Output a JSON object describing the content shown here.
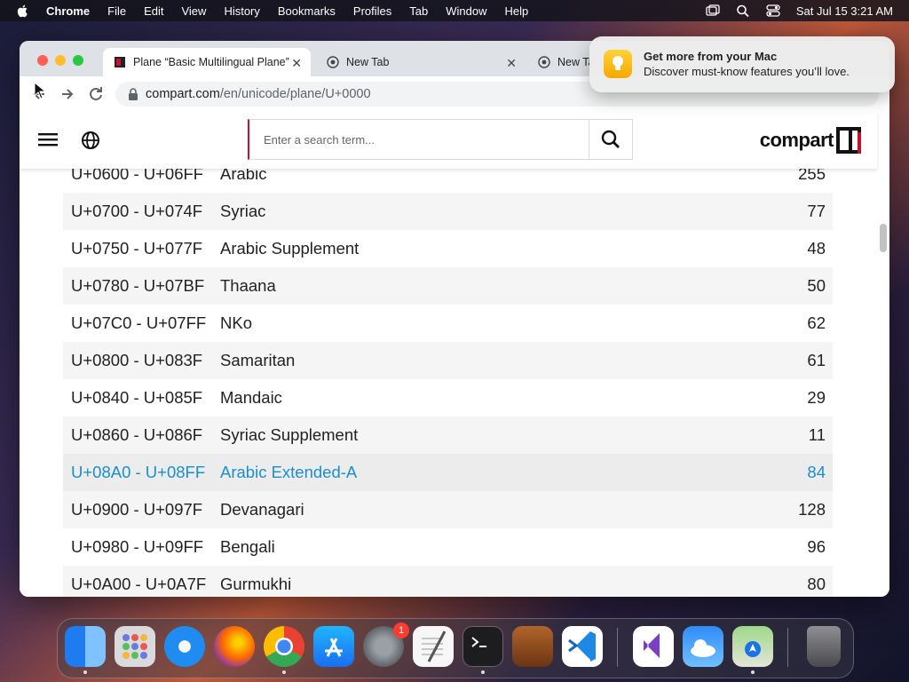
{
  "menubar": {
    "app_name": "Chrome",
    "items": [
      "File",
      "Edit",
      "View",
      "History",
      "Bookmarks",
      "Profiles",
      "Tab",
      "Window",
      "Help"
    ],
    "clock": "Sat Jul 15  3:21 AM"
  },
  "browser": {
    "tabs": [
      {
        "title": "Plane “Basic Multilingual Plane”",
        "active": true
      },
      {
        "title": "New Tab",
        "active": false
      },
      {
        "title": "New Tab",
        "active": false
      }
    ],
    "url_domain": "compart.com",
    "url_path": "/en/unicode/plane/U+0000"
  },
  "site": {
    "search_placeholder": "Enter a search term...",
    "logo_text": "compart"
  },
  "blocks": [
    {
      "range": "U+0600 - U+06FF",
      "name": "Arabic",
      "count": "255"
    },
    {
      "range": "U+0700 - U+074F",
      "name": "Syriac",
      "count": "77"
    },
    {
      "range": "U+0750 - U+077F",
      "name": "Arabic Supplement",
      "count": "48"
    },
    {
      "range": "U+0780 - U+07BF",
      "name": "Thaana",
      "count": "50"
    },
    {
      "range": "U+07C0 - U+07FF",
      "name": "NKo",
      "count": "62"
    },
    {
      "range": "U+0800 - U+083F",
      "name": "Samaritan",
      "count": "61"
    },
    {
      "range": "U+0840 - U+085F",
      "name": "Mandaic",
      "count": "29"
    },
    {
      "range": "U+0860 - U+086F",
      "name": "Syriac Supplement",
      "count": "11"
    },
    {
      "range": "U+08A0 - U+08FF",
      "name": "Arabic Extended-A",
      "count": "84",
      "selected": true
    },
    {
      "range": "U+0900 - U+097F",
      "name": "Devanagari",
      "count": "128"
    },
    {
      "range": "U+0980 - U+09FF",
      "name": "Bengali",
      "count": "96"
    },
    {
      "range": "U+0A00 - U+0A7F",
      "name": "Gurmukhi",
      "count": "80"
    }
  ],
  "notification": {
    "title": "Get more from your Mac",
    "body": "Discover must-know features you’ll love."
  },
  "dock": {
    "apps": [
      "finder",
      "launchpad",
      "safari",
      "firefox",
      "chrome",
      "app-store",
      "system-settings",
      "textedit",
      "terminal",
      "garageband",
      "vscode",
      "visual-studio",
      "weather",
      "maps",
      "trash"
    ],
    "settings_badge": "1"
  },
  "colors": {
    "link_blue": "#1a8fd0",
    "brand_red": "#c8102e"
  }
}
